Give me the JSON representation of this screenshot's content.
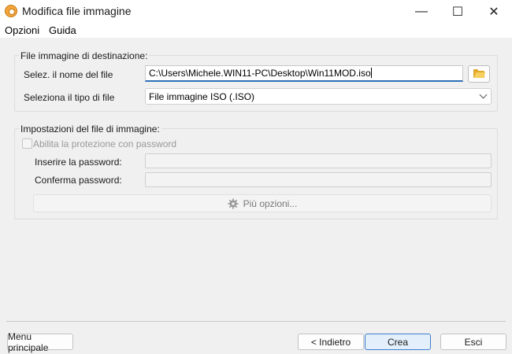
{
  "window": {
    "title": "Modifica file immagine",
    "controls": {
      "minimize": "—",
      "maximize": "☐",
      "close": "✕"
    }
  },
  "menu": {
    "items": [
      "Opzioni",
      "Guida"
    ]
  },
  "destination": {
    "group_title": "File immagine di destinazione:",
    "filename_label": "Selez. il nome del file",
    "filename_value": "C:\\Users\\Michele.WIN11-PC\\Desktop\\Win11MOD.iso",
    "filetype_label": "Seleziona il tipo di file",
    "filetype_value": "File immagine ISO (.ISO)"
  },
  "settings": {
    "group_title": "Impostazioni del file di immagine:",
    "password_checkbox_label": "Abilita la protezione con password",
    "password_checkbox_checked": false,
    "password_label": "Inserire la password:",
    "confirm_label": "Conferma password:",
    "more_options": "Più opzioni..."
  },
  "footer": {
    "main_menu": "Menu principale",
    "back": "< Indietro",
    "create": "Crea",
    "exit": "Esci"
  },
  "icons": {
    "app": "disc-icon",
    "browse": "folder-icon",
    "more_options": "gear-icon",
    "dropdown": "chevron-down-icon"
  },
  "colors": {
    "accent": "#2c6fb7",
    "primary_button_bg": "#e3effa",
    "folder": "#e0a92b"
  }
}
